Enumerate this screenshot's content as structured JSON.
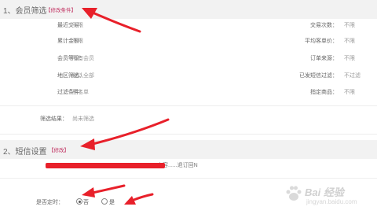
{
  "section1": {
    "title": "1、会员筛选",
    "edit_label": "【修改条件】"
  },
  "filters": {
    "left": [
      {
        "label": "最近交易：",
        "value": "不限"
      },
      {
        "label": "累计金额：",
        "value": "不限"
      },
      {
        "label": "会员等级：",
        "value": "所有会员"
      },
      {
        "label": "地区筛选：",
        "value": "默认全部"
      },
      {
        "label": "过滤条件：",
        "value": "黑名单"
      }
    ],
    "right": [
      {
        "label": "交易次数：",
        "value": "不限"
      },
      {
        "label": "平均客单价：",
        "value": "不限"
      },
      {
        "label": "订单来源：",
        "value": "不限"
      },
      {
        "label": "已发短信过滤：",
        "value": "不过滤"
      },
      {
        "label": "指定商品：",
        "value": "不限"
      }
    ],
    "result": {
      "label": "筛选结果：",
      "value": "尚未筛选"
    }
  },
  "section2": {
    "title": "2、短信设置",
    "edit_label": "【修改】",
    "sms_text": "内容......退订回N"
  },
  "schedule": {
    "label": "是否定时：",
    "options": [
      {
        "label": "否",
        "checked": true
      },
      {
        "label": "是",
        "checked": false
      }
    ]
  },
  "watermark": {
    "text": "Bai 经验",
    "sub": "jingyan.baidu.com"
  },
  "colors": {
    "accent_red": "#e8202a",
    "edit_link": "#c03060",
    "header_bg": "#f2f2f2"
  }
}
